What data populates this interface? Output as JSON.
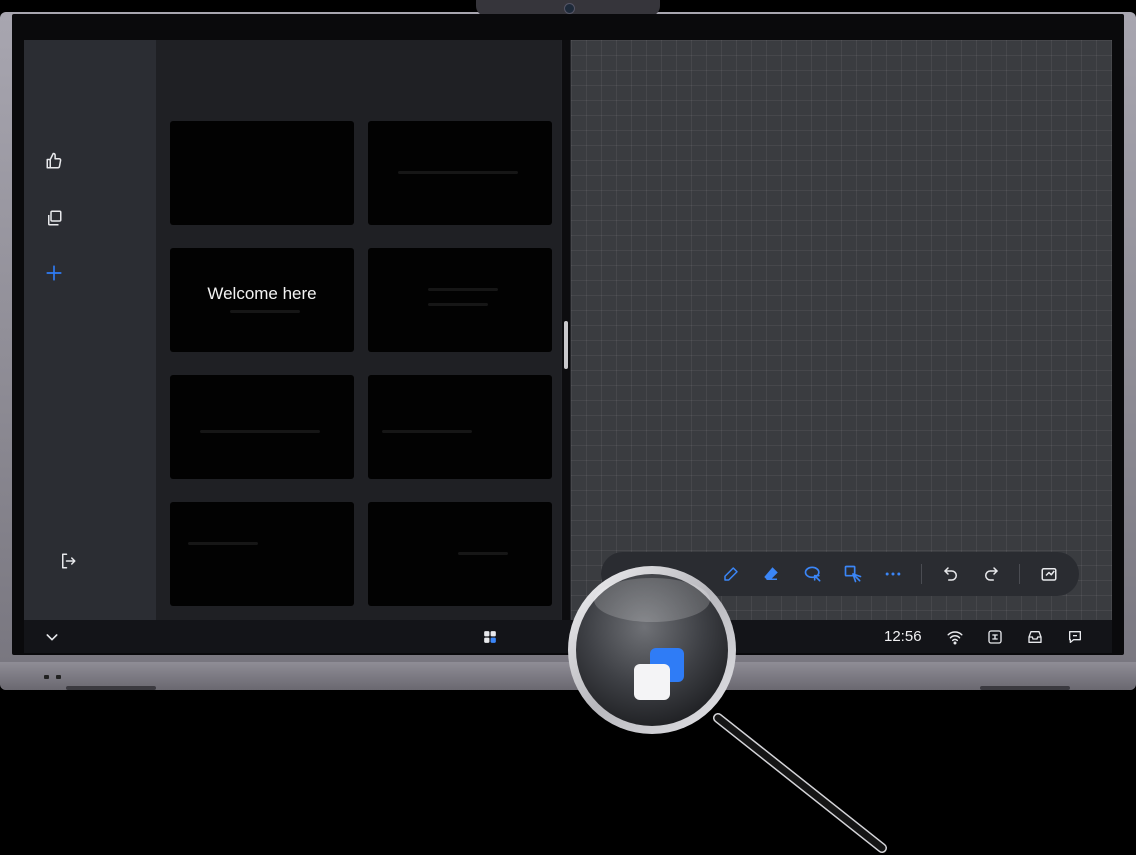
{
  "slides_panel": {
    "thumbnails": [
      {
        "text": ""
      },
      {
        "text": ""
      },
      {
        "text": "Welcome here"
      },
      {
        "text": ""
      },
      {
        "text": ""
      },
      {
        "text": ""
      },
      {
        "text": ""
      },
      {
        "text": ""
      }
    ]
  },
  "sidebar": {
    "icons": [
      "thumbs-up-icon",
      "copy-pages-icon",
      "add-icon",
      "exit-icon"
    ],
    "accent_color": "#2f7cf6"
  },
  "toolbar": {
    "tools": [
      "pen-icon",
      "eraser-icon",
      "lasso-select-icon",
      "smart-select-icon",
      "more-icon",
      "undo-icon",
      "redo-icon",
      "export-icon"
    ],
    "accent_color": "#3b86f7"
  },
  "taskbar": {
    "clock": "12:56",
    "icons": [
      "collapse-chevron-icon",
      "apps-grid-icon",
      "wifi-icon",
      "screen-share-icon",
      "tray-icon",
      "message-icon"
    ]
  },
  "magnifier": {
    "highlighted_icon": "multi-window-icon"
  }
}
